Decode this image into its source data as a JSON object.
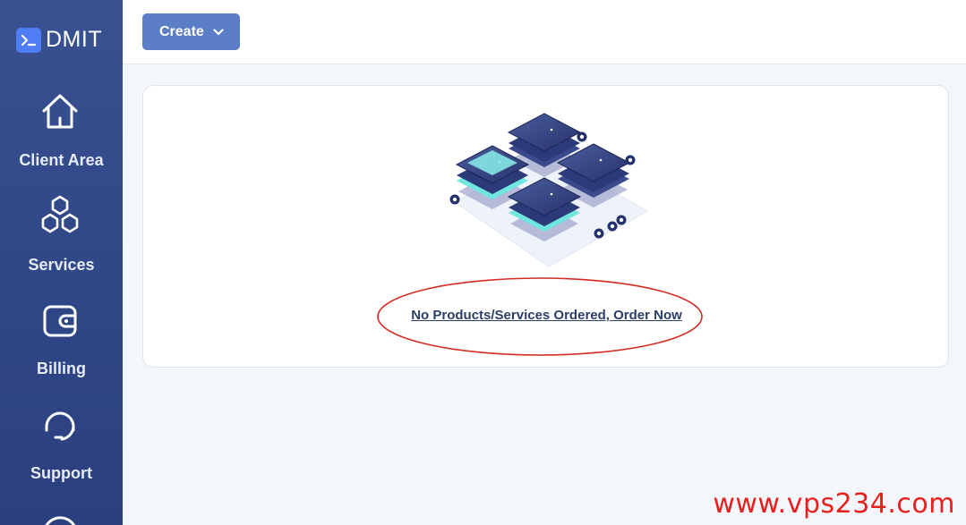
{
  "sidebar": {
    "brand": "DMIT",
    "items": [
      {
        "label": "Client Area",
        "icon": "home-icon"
      },
      {
        "label": "Services",
        "icon": "cubes-icon"
      },
      {
        "label": "Billing",
        "icon": "wallet-icon"
      },
      {
        "label": "Support",
        "icon": "headset-icon"
      }
    ]
  },
  "toolbar": {
    "create_label": "Create"
  },
  "main": {
    "empty_link": "No Products/Services Ordered, Order Now"
  },
  "watermark": "www.vps234.com",
  "colors": {
    "sidebar": "#34498a",
    "accent": "#5b7ec7",
    "logo": "#4f7df3",
    "annotation": "#d32a22"
  }
}
